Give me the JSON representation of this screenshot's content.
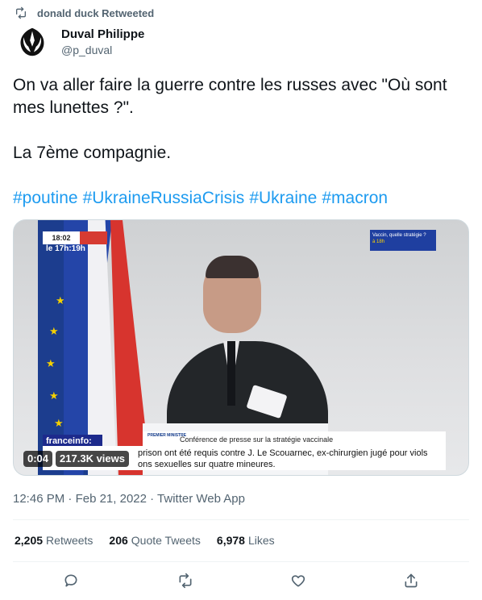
{
  "retweet": {
    "label": "donald duck Retweeted"
  },
  "author": {
    "display_name": "Duval Philippe",
    "handle": "@p_duval"
  },
  "tweet": {
    "line1": "On va aller faire la guerre contre les russes avec \"Où sont mes lunettes ?\".",
    "line2": "La 7ème compagnie.",
    "hashtags": [
      "#poutine",
      "#UkraineRussiaCrisis",
      "#Ukraine",
      "#macron"
    ]
  },
  "video": {
    "elapsed": "0:04",
    "views": "217.3K views",
    "overlay": {
      "clock": "18:02",
      "time_label": "le 17h:19h",
      "channel": "franceinfo:",
      "conference": "Conférence de presse sur la stratégie vaccinale",
      "gov_label": "PREMIER MINISTRE",
      "ticker_line1": "prison ont été requis contre J. Le Scouarnec, ex-chirurgien jugé pour viols",
      "ticker_line2": "ons sexuelles sur quatre mineures.",
      "inset_title": "Vaccin, quelle stratégie ?",
      "inset_time": "à 18h"
    }
  },
  "meta": {
    "time": "12:46 PM",
    "date": "Feb 21, 2022",
    "source": "Twitter Web App",
    "sep": "·"
  },
  "stats": {
    "retweets_count": "2,205",
    "retweets_label": "Retweets",
    "quotes_count": "206",
    "quotes_label": "Quote Tweets",
    "likes_count": "6,978",
    "likes_label": "Likes"
  },
  "icons": [
    "retweet-icon",
    "rebel-alliance-avatar",
    "reply-icon",
    "retweet-icon",
    "like-icon",
    "share-icon"
  ],
  "colors": {
    "link": "#1d9bf0",
    "secondary": "#536471",
    "text": "#0f1419"
  }
}
